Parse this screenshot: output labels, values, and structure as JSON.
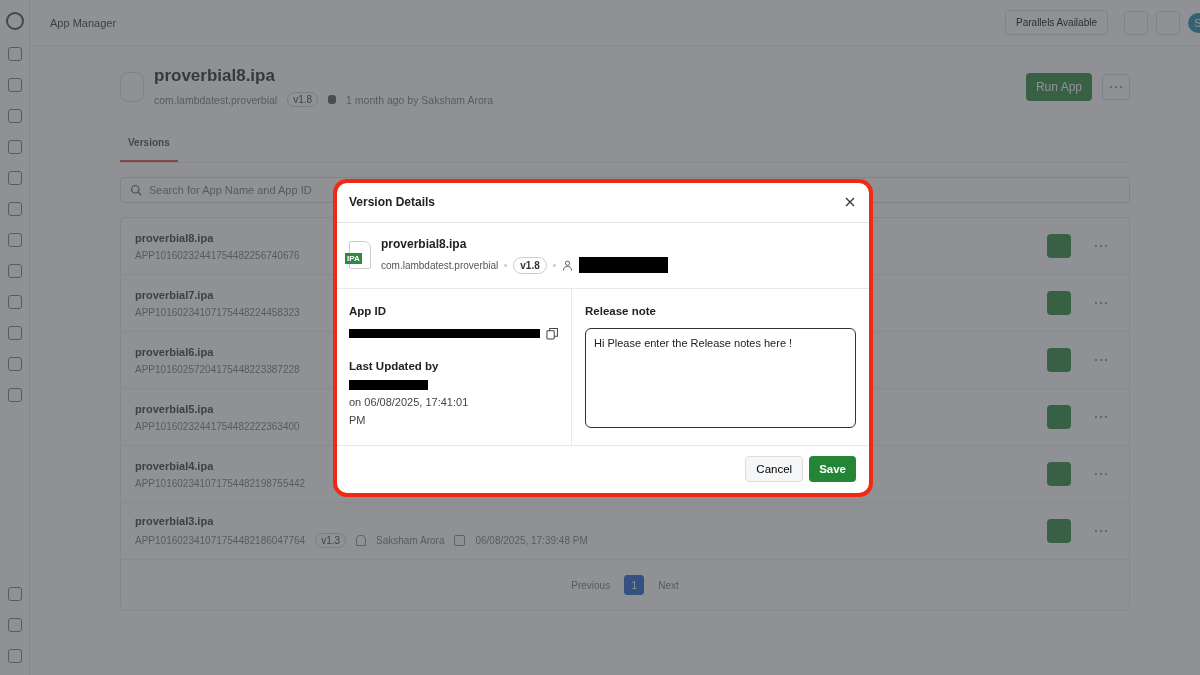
{
  "topbar": {
    "title": "App Manager",
    "parallels": "Parallels Available",
    "avatar": "S"
  },
  "app": {
    "name": "proverbial8.ipa",
    "bundle": "com.lambdatest.proverbial",
    "version": "v1.8",
    "updated": "1 month ago by Saksham Arora",
    "run_button": "Run App"
  },
  "tabs": [
    {
      "label": "Versions",
      "selected": true
    }
  ],
  "search": {
    "placeholder": "Search for App Name and App ID"
  },
  "versions": [
    {
      "name": "proverbial8.ipa",
      "app_id": "APP10160232441754482256740676"
    },
    {
      "name": "proverbial7.ipa",
      "app_id": "APP10160234107175448224458323"
    },
    {
      "name": "proverbial6.ipa",
      "app_id": "APP10160257204175448223387228"
    },
    {
      "name": "proverbial5.ipa",
      "app_id": "APP10160232441754482222363400"
    },
    {
      "name": "proverbial4.ipa",
      "app_id": "APP1016023410717544821987554​42"
    },
    {
      "name": "proverbial3.ipa",
      "app_id": "APP1016023410717544821860477​64",
      "version": "v1.3",
      "user": "Saksham Arora",
      "date": "06/08/2025, 17:39:48 PM"
    }
  ],
  "pagination": {
    "previous": "Previous",
    "pages": [
      {
        "label": "1",
        "selected": true
      }
    ],
    "next": "Next"
  },
  "dialog": {
    "title": "Version Details",
    "file_badge": "IPA",
    "name": "proverbial8.ipa",
    "bundle": "com.lambdatest.proverbial",
    "version": "v1.8",
    "app_id_label": "App ID",
    "last_updated_label": "Last Updated by",
    "last_updated": "on 06/08/2025, 17:41:01 PM",
    "release_label": "Release note",
    "release_note": "Hi Please enter the Release notes here !",
    "cancel": "Cancel",
    "save": "Save"
  }
}
